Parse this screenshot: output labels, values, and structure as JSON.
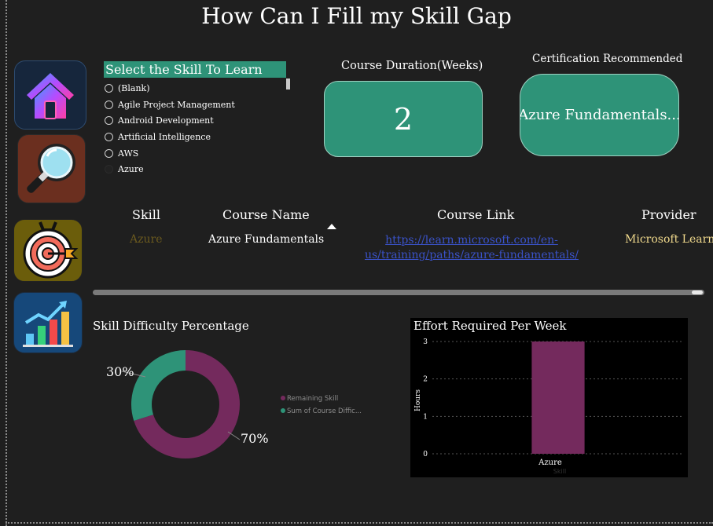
{
  "title": "How Can I Fill my Skill Gap",
  "nav": {
    "home_icon": "home-icon",
    "search_icon": "magnifier-icon",
    "target_icon": "target-icon",
    "chart_icon": "growth-chart-icon"
  },
  "slicer": {
    "header": "Select the Skill To Learn",
    "items": [
      {
        "label": "(Blank)",
        "selected": false
      },
      {
        "label": "Agile Project Management",
        "selected": false
      },
      {
        "label": "Android Development",
        "selected": false
      },
      {
        "label": "Artificial Intelligence",
        "selected": false
      },
      {
        "label": "AWS",
        "selected": false
      },
      {
        "label": "Azure",
        "selected": true
      }
    ]
  },
  "duration": {
    "label": "Course Duration(Weeks)",
    "value": "2"
  },
  "certification": {
    "label": "Certification Recommended",
    "value": "Azure Fundamentals..."
  },
  "table": {
    "headers": {
      "skill": "Skill",
      "course": "Course Name",
      "link": "Course Link",
      "provider": "Provider"
    },
    "row": {
      "skill": "Azure",
      "course": "Azure Fundamentals",
      "link": "https://learn.microsoft.com/en-us/training/paths/azure-fundamentals/",
      "provider": "Microsoft Learn"
    }
  },
  "colors": {
    "accent": "#2e9378",
    "donut_remaining": "#742a5d",
    "donut_course": "#2e9378",
    "bar": "#742a5d"
  },
  "chart_data": [
    {
      "type": "pie",
      "title": "Skill Difficulty Percentage",
      "labels": [
        "Remaining Skill",
        "Sum of Course Diffic..."
      ],
      "values": [
        70,
        30
      ],
      "value_labels": [
        "70%",
        "30%"
      ],
      "legend": "right"
    },
    {
      "type": "bar",
      "title": "Effort Required Per Week",
      "categories": [
        "Azure"
      ],
      "values": [
        3
      ],
      "xlabel": "Skill",
      "ylabel": "Hours",
      "ylim": [
        0,
        3
      ],
      "yticks": [
        "0",
        "1",
        "2",
        "3"
      ],
      "grid": true
    }
  ]
}
